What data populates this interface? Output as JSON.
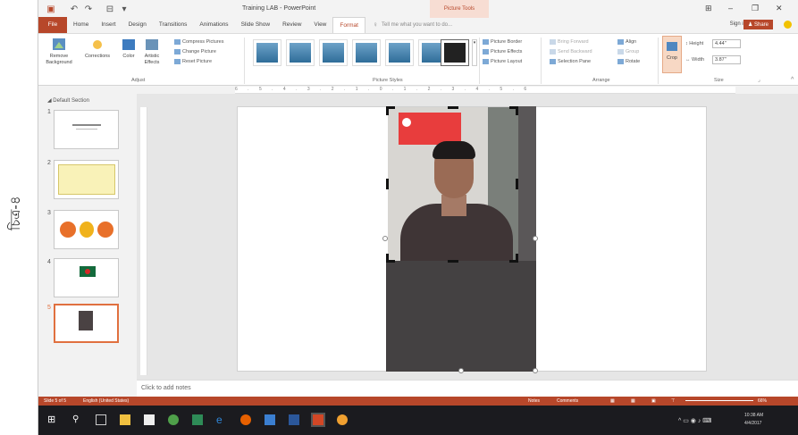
{
  "figure_label": "চিত্র-৪",
  "window": {
    "title": "Training LAB - PowerPoint",
    "context_tab": "Picture Tools"
  },
  "tabs": [
    "File",
    "Home",
    "Insert",
    "Design",
    "Transitions",
    "Animations",
    "Slide Show",
    "Review",
    "View",
    "Format"
  ],
  "tell_me_placeholder": "Tell me what you want to do...",
  "sign_in": "Sign in",
  "share": "Share",
  "ribbon": {
    "adjust": {
      "remove_background": "Remove Background",
      "corrections": "Corrections",
      "color": "Color",
      "artistic_effects": "Artistic Effects",
      "compress": "Compress Pictures",
      "change": "Change Picture",
      "reset": "Reset Picture"
    },
    "styles": {
      "border": "Picture Border",
      "effects": "Picture Effects",
      "layout": "Picture Layout"
    },
    "arrange": {
      "bring_forward": "Bring Forward",
      "send_backward": "Send Backward",
      "selection_pane": "Selection Pane",
      "align": "Align",
      "group": "Group",
      "rotate": "Rotate"
    },
    "size": {
      "crop": "Crop",
      "height_label": "Height",
      "height_value": "4.44\"",
      "width_label": "Width",
      "width_value": "3.87\""
    },
    "groups": {
      "adjust": "Adjust",
      "picture_styles": "Picture Styles",
      "arrange": "Arrange",
      "size": "Size"
    }
  },
  "section": "Default Section",
  "slides": [
    "1",
    "2",
    "3",
    "4",
    "5"
  ],
  "ruler": "6 . 5 . 4 . 3 . 2 . 1 . 0 . 1 . 2 . 3 . 4 . 5 . 6",
  "notes_placeholder": "Click to add notes",
  "status": {
    "slide": "Slide 5 of 5",
    "language": "English (United States)",
    "notes": "Notes",
    "comments": "Comments",
    "zoom": "66%"
  },
  "taskbar": {
    "time": "10:38 AM",
    "date": "4/4/2017"
  }
}
